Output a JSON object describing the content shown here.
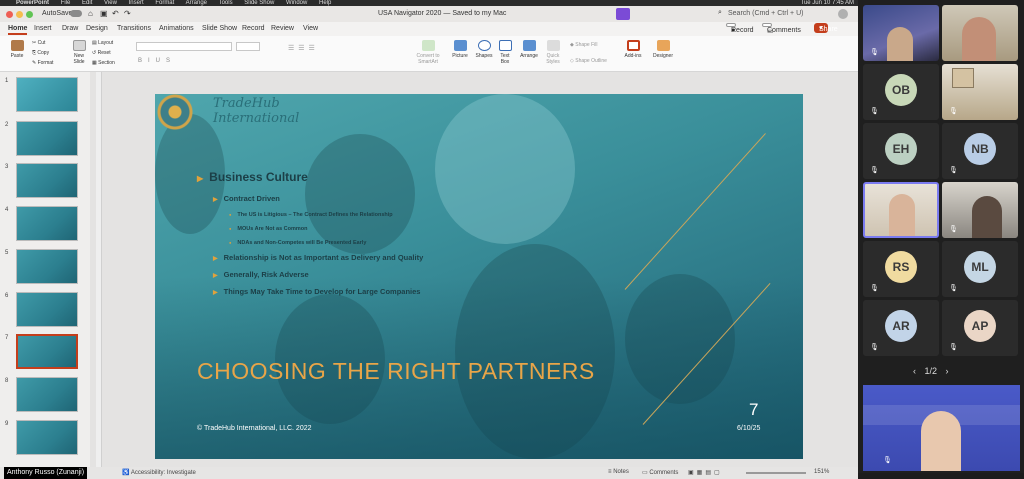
{
  "macbar": {
    "apple": "",
    "app": "PowerPoint",
    "menus": [
      "File",
      "Edit",
      "View",
      "Insert",
      "Format",
      "Arrange",
      "Tools",
      "Slide Show",
      "Window",
      "Help"
    ],
    "clock": "Tue Jun 10  7:45 AM"
  },
  "titlebar": {
    "autosave": "AutoSave",
    "doc_title": "USA Navigator 2020 — Saved to my Mac",
    "search_placeholder": "Search (Cmd + Ctrl + U)"
  },
  "tabs": [
    "Home",
    "Insert",
    "Draw",
    "Design",
    "Transitions",
    "Animations",
    "Slide Show",
    "Record",
    "Review",
    "View"
  ],
  "tabs_right": {
    "record": "Record",
    "comments": "Comments",
    "share": "Share"
  },
  "ribbon": {
    "paste": "Paste",
    "cut": "Cut",
    "copy": "Copy",
    "format": "Format",
    "new_slide": "New Slide",
    "layout": "Layout",
    "reset": "Reset",
    "section": "Section",
    "convert": "Convert to SmartArt",
    "picture": "Picture",
    "shapes": "Shapes",
    "textbox": "Text Box",
    "arrange": "Arrange",
    "quick_styles": "Quick Styles",
    "shape_fill": "Shape Fill",
    "shape_outline": "Shape Outline",
    "addins": "Add-ins",
    "designer": "Designer"
  },
  "thumbnails": [
    "1",
    "2",
    "3",
    "4",
    "5",
    "6",
    "7",
    "8",
    "9"
  ],
  "slide": {
    "logo_line1": "TradeHub",
    "logo_line2": "International",
    "heading": "Business Culture",
    "bullets": [
      {
        "level": 2,
        "text": "Contract Driven"
      },
      {
        "level": 3,
        "text": "The US is Litigious – The Contract Defines the Relationship"
      },
      {
        "level": 3,
        "text": "MOUs Are Not as Common"
      },
      {
        "level": 3,
        "text": "NDAs and Non-Competes will Be Presented Early"
      },
      {
        "level": 2,
        "text": "Relationship is Not as Important as Delivery and Quality"
      },
      {
        "level": 2,
        "text": "Generally, Risk Adverse"
      },
      {
        "level": 2,
        "text": "Things May Take Time to Develop for Large Companies"
      }
    ],
    "title": "CHOOSING THE RIGHT PARTNERS",
    "number": "7",
    "date": "6/10/25",
    "copyright": "© TradeHub International, LLC. 2022"
  },
  "statusbar": {
    "user": "Anthony Russo (Zunanji)",
    "accessibility": "Accessibility: Investigate",
    "notes": "Notes",
    "comments": "Comments",
    "zoom": "151%"
  },
  "zoom_panel": {
    "tiles": [
      "",
      "",
      "OB",
      "",
      "EH",
      "NB",
      "",
      "",
      "RS",
      "ML",
      "AR",
      "AP"
    ],
    "pager": "1/2",
    "colors": {
      "accent": "#7b7bf0",
      "avatar_bg": "#c8d8b8"
    }
  }
}
